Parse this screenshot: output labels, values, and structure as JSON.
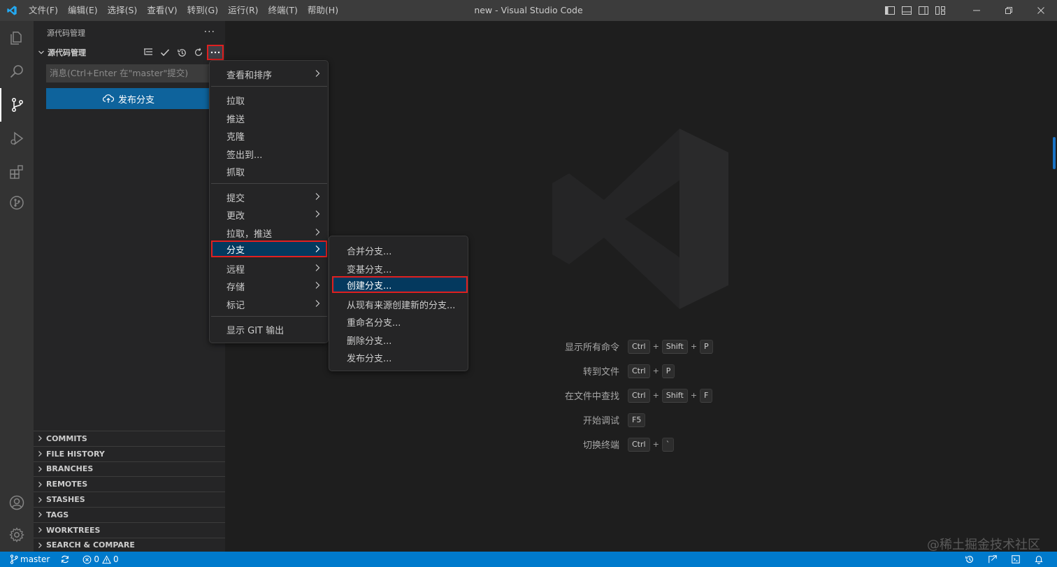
{
  "titlebar": {
    "menus": [
      "文件(F)",
      "编辑(E)",
      "选择(S)",
      "查看(V)",
      "转到(G)",
      "运行(R)",
      "终端(T)",
      "帮助(H)"
    ],
    "window_title": "new - Visual Studio Code"
  },
  "sidebar": {
    "header": "源代码管理",
    "header_more": "···",
    "scm_title": "源代码管理",
    "commit_placeholder": "消息(Ctrl+Enter 在\"master\"提交)",
    "publish_label": "发布分支",
    "views": [
      "COMMITS",
      "FILE HISTORY",
      "BRANCHES",
      "REMOTES",
      "STASHES",
      "TAGS",
      "WORKTREES",
      "SEARCH & COMPARE"
    ]
  },
  "context_menu": {
    "items": [
      {
        "label": "查看和排序",
        "submenu": true
      },
      {
        "label": "拉取"
      },
      {
        "label": "推送"
      },
      {
        "label": "克隆"
      },
      {
        "label": "签出到..."
      },
      {
        "label": "抓取"
      },
      {
        "label": "提交",
        "submenu": true
      },
      {
        "label": "更改",
        "submenu": true
      },
      {
        "label": "拉取，推送",
        "submenu": true
      },
      {
        "label": "分支",
        "submenu": true,
        "active": true
      },
      {
        "label": "远程",
        "submenu": true
      },
      {
        "label": "存储",
        "submenu": true
      },
      {
        "label": "标记",
        "submenu": true
      },
      {
        "label": "显示 GIT 输出"
      }
    ]
  },
  "branch_submenu": {
    "items": [
      "合并分支...",
      "变基分支...",
      "创建分支...",
      "从现有来源创建新的分支...",
      "重命名分支...",
      "删除分支...",
      "发布分支..."
    ],
    "active_index": 2
  },
  "shortcuts": [
    {
      "label": "显示所有命令",
      "keys": [
        "Ctrl",
        "Shift",
        "P"
      ]
    },
    {
      "label": "转到文件",
      "keys": [
        "Ctrl",
        "P"
      ]
    },
    {
      "label": "在文件中查找",
      "keys": [
        "Ctrl",
        "Shift",
        "F"
      ]
    },
    {
      "label": "开始调试",
      "keys": [
        "F5"
      ]
    },
    {
      "label": "切换终端",
      "keys": [
        "Ctrl",
        "`"
      ]
    }
  ],
  "statusbar": {
    "branch": "master",
    "errors": "0",
    "warnings": "0"
  },
  "watermark": "@稀土掘金技术社区",
  "colors": {
    "accent": "#007acc",
    "highlight_border": "#e02020",
    "menu_active_bg": "#04395e",
    "publish_button": "#0e639c"
  }
}
